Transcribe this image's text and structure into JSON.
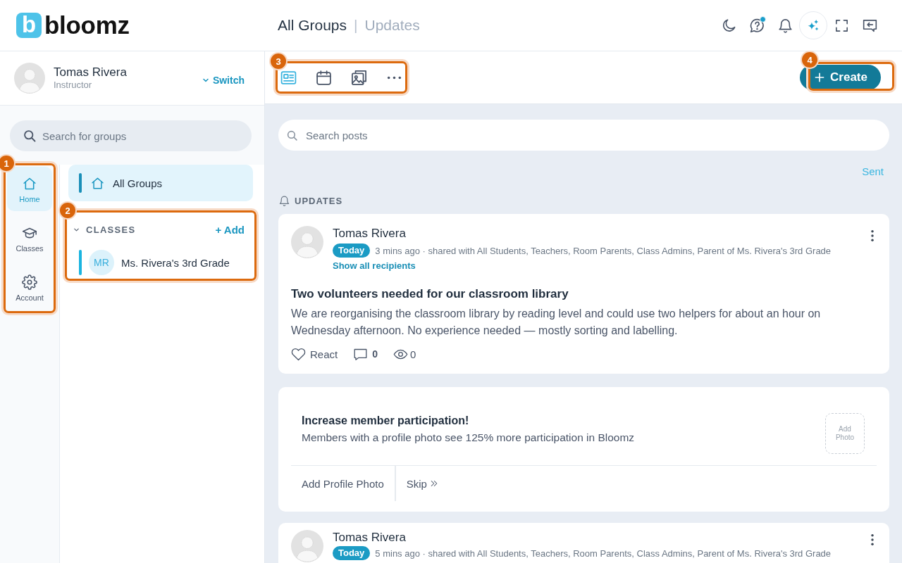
{
  "header": {
    "logo": {
      "mark": "b",
      "wordmark": "bloomz"
    },
    "title": "All Groups",
    "separator": "|",
    "subtitle": "Updates",
    "icons": [
      {
        "kind": "moon",
        "dot": false
      },
      {
        "kind": "help",
        "dot": true
      },
      {
        "kind": "bell",
        "dot": false
      },
      {
        "kind": "sparkle",
        "dot": false
      },
      {
        "kind": "expand",
        "dot": false
      },
      {
        "kind": "exit",
        "dot": false
      }
    ]
  },
  "profile": {
    "name": "Tomas Rivera",
    "role": "Instructor",
    "switch_label": "Switch"
  },
  "group_search": {
    "placeholder": "Search for groups"
  },
  "nav_rail": {
    "callout": "1",
    "items": [
      {
        "kind": "home",
        "label": "Home",
        "selected": true
      },
      {
        "kind": "classes",
        "label": "Classes",
        "selected": false
      },
      {
        "kind": "account",
        "label": "Account",
        "selected": false
      }
    ]
  },
  "groups": {
    "all_groups": {
      "label": "All Groups",
      "selected": true
    },
    "classes": {
      "callout": "2",
      "heading": "CLASSES",
      "expanded": true,
      "add_label": "+ Add",
      "items": [
        {
          "initials": "MR",
          "name": "Ms. Rivera's 3rd Grade",
          "color": "#1ab4e0"
        }
      ]
    }
  },
  "toolbar": {
    "callout": "3",
    "items": [
      {
        "kind": "post",
        "selected": true
      },
      {
        "kind": "calendar",
        "selected": false
      },
      {
        "kind": "photos",
        "selected": false
      },
      {
        "kind": "more",
        "selected": false
      }
    ]
  },
  "create_button": {
    "label": "Create",
    "callout": "4"
  },
  "post_search": {
    "placeholder": "Search posts"
  },
  "filter_link": "Sent",
  "section_heading": "UPDATES",
  "feed": [
    {
      "kind": "post",
      "author": "Tomas Rivera",
      "badge": "Today",
      "meta": "3 mins ago · shared with All Students, Teachers, Room Parents, Class Admins, Parent of Ms. Rivera's 3rd Grade",
      "recipients_link": "Show all recipients",
      "title": "Two volunteers needed for our classroom library",
      "body": "We are reorganising the classroom library by reading level and could use two helpers for about an hour on Wednesday afternoon. No experience needed — mostly sorting and labelling.",
      "react_label": "React",
      "comments": "0",
      "views": "0"
    },
    {
      "kind": "prompt",
      "title": "Increase member participation!",
      "text": "Members with a profile photo see 125% more participation in Bloomz",
      "photo_label": "Add Photo",
      "actions": [
        {
          "kind": "plain",
          "label": "Add Profile Photo"
        },
        {
          "kind": "skip",
          "label": "Skip"
        }
      ]
    },
    {
      "kind": "post",
      "author": "Tomas Rivera",
      "badge": "Today",
      "meta": "5 mins ago · shared with All Students, Teachers, Room Parents, Class Admins, Parent of Ms. Rivera's 3rd Grade"
    }
  ]
}
